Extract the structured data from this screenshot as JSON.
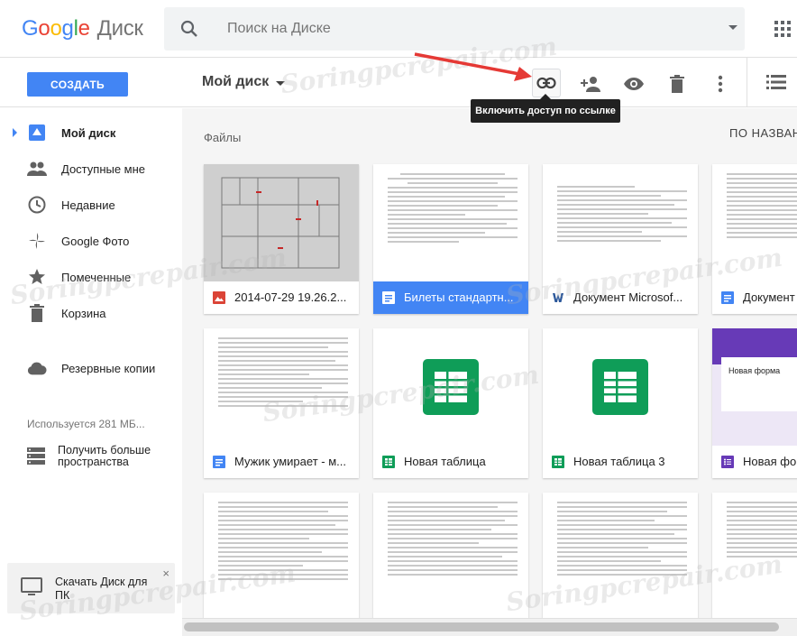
{
  "app": {
    "logo_google": [
      "G",
      "o",
      "o",
      "g",
      "l",
      "e"
    ],
    "logo_product": "Диск"
  },
  "search": {
    "placeholder": "Поиск на Диске"
  },
  "toolbar": {
    "create_label": "СОЗДАТЬ",
    "title": "Мой диск",
    "tooltip": "Включить доступ по ссылке"
  },
  "sidebar": {
    "items": [
      {
        "label": "Мой диск",
        "icon": "drive-icon",
        "active": true
      },
      {
        "label": "Доступные мне",
        "icon": "people-icon",
        "active": false
      },
      {
        "label": "Недавние",
        "icon": "clock-icon",
        "active": false
      },
      {
        "label": "Google Фото",
        "icon": "photos-icon",
        "active": false
      },
      {
        "label": "Помеченные",
        "icon": "star-icon",
        "active": false
      },
      {
        "label": "Корзина",
        "icon": "trash-icon",
        "active": false
      },
      {
        "label": "Резервные копии",
        "icon": "cloud-icon",
        "active": false
      }
    ],
    "usage": "Используется 281 МБ...",
    "upgrade": "Получить больше пространства",
    "download": "Скачать Диск для ПК",
    "download_close": "×"
  },
  "main": {
    "section": "Файлы",
    "sort": "ПО НАЗВАН",
    "files": [
      {
        "name": "2014-07-29 19.26.2...",
        "type": "image",
        "icon_color": "#db4437",
        "selected": false
      },
      {
        "name": "Билеты стандартн...",
        "type": "doc",
        "icon_color": "#4285f4",
        "selected": true
      },
      {
        "name": "Документ Microsof...",
        "type": "word",
        "icon_color": "#2b579a",
        "selected": false
      },
      {
        "name": "Документ",
        "type": "doc",
        "icon_color": "#4285f4",
        "selected": false
      },
      {
        "name": "Мужик умирает - м...",
        "type": "doc",
        "icon_color": "#4285f4",
        "selected": false
      },
      {
        "name": "Новая таблица",
        "type": "sheet",
        "icon_color": "#0f9d58",
        "selected": false
      },
      {
        "name": "Новая таблица 3",
        "type": "sheet",
        "icon_color": "#0f9d58",
        "selected": false
      },
      {
        "name": "Новая фор",
        "type": "form",
        "icon_color": "#673ab7",
        "selected": false
      }
    ],
    "form_thumb_title": "Новая форма"
  },
  "watermark": "Soringpcrepair.com",
  "colors": {
    "accent": "#4285f4",
    "sheet": "#0f9d58",
    "form": "#673ab7",
    "arrow": "#e53935"
  }
}
